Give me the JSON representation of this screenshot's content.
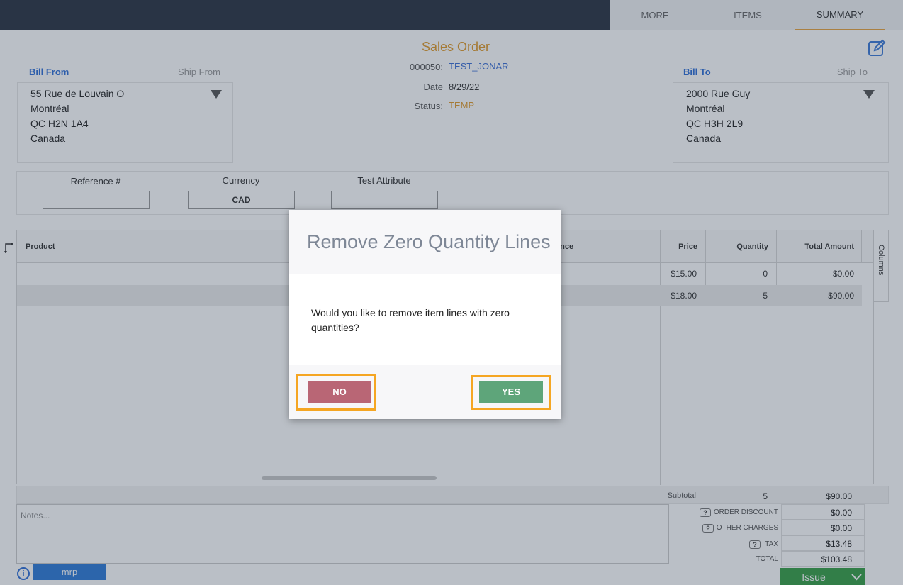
{
  "tabs": {
    "more": "MORE",
    "items": "ITEMS",
    "summary": "SUMMARY"
  },
  "order": {
    "title": "Sales Order",
    "number": "000050:",
    "name": "TEST_JONAR",
    "date_label": "Date",
    "date": "8/29/22",
    "status_label": "Status:",
    "status": "TEMP"
  },
  "bill_from": {
    "tab_active": "Bill From",
    "tab_inactive": "Ship From",
    "lines": [
      "55 Rue de Louvain O",
      "Montréal",
      "QC H2N 1A4",
      "Canada"
    ]
  },
  "bill_to": {
    "tab_active": "Bill To",
    "tab_inactive": "Ship To",
    "lines": [
      "2000 Rue Guy",
      "Montréal",
      "QC H3H 2L9",
      "Canada"
    ]
  },
  "attributes": {
    "reference_label": "Reference #",
    "reference_value": "",
    "currency_label": "Currency",
    "currency_value": "CAD",
    "test_label": "Test Attribute",
    "test_value": ""
  },
  "grid": {
    "columns": {
      "product": "Product",
      "reference": "ence",
      "price": "Price",
      "quantity": "Quantity",
      "total": "Total Amount"
    },
    "rows": [
      {
        "price": "$15.00",
        "quantity": "0",
        "total": "$0.00"
      },
      {
        "price": "$18.00",
        "quantity": "5",
        "total": "$90.00"
      }
    ],
    "columns_tab": "Columns"
  },
  "totals": {
    "subtotal_label": "Subtotal",
    "subtotal_qty": "5",
    "subtotal_amount": "$90.00",
    "order_discount_label": "ORDER DISCOUNT",
    "order_discount": "$0.00",
    "other_charges_label": "OTHER CHARGES",
    "other_charges": "$0.00",
    "tax_label": "TAX",
    "tax": "$13.48",
    "total_label": "TOTAL",
    "total": "$103.48",
    "help_glyph": "?"
  },
  "notes": {
    "placeholder": "Notes..."
  },
  "footer": {
    "info_glyph": "i",
    "mrp_label": "mrp",
    "issue_label": "Issue"
  },
  "dialog": {
    "title": "Remove Zero Quantity Lines",
    "message": "Would you like to remove item lines with zero quantities?",
    "no_label": "NO",
    "yes_label": "YES"
  },
  "colors": {
    "accent_orange": "#e09a2a",
    "link_blue": "#2f6fd8",
    "no_button": "#b96675",
    "yes_button": "#5ea57a",
    "highlight": "#f5a623"
  }
}
